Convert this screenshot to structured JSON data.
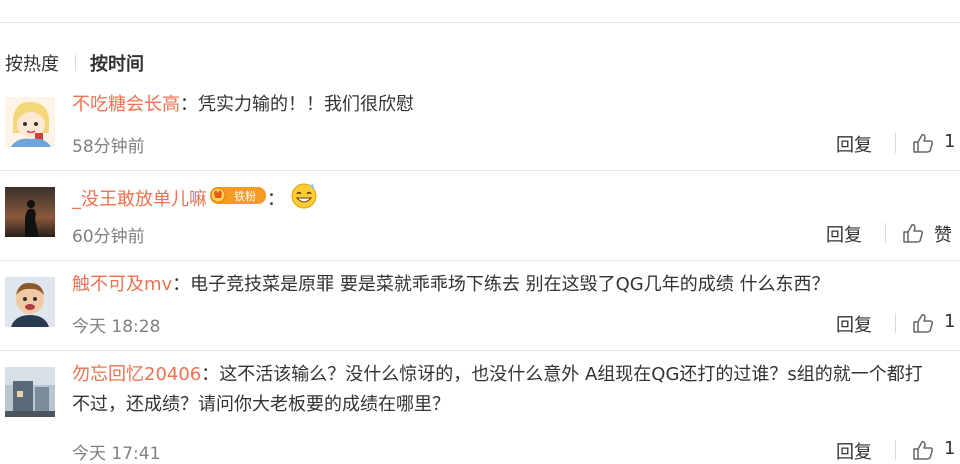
{
  "sort": {
    "hot_label": "按热度",
    "time_label": "按时间"
  },
  "comments": [
    {
      "username": "不吃糖会长高",
      "text": "：凭实力输的！！我们很欣慰",
      "time": "58分钟前",
      "reply_label": "回复",
      "like_label": "1"
    },
    {
      "username": "_没王敢放单儿嘛",
      "badge_text": "铁粉",
      "text": "：",
      "emoji": "grinning-sweat-emoji",
      "time": "60分钟前",
      "reply_label": "回复",
      "like_label": "赞"
    },
    {
      "username": "触不可及mv",
      "text": "：电子竞技菜是原罪 要是菜就乖乖场下练去 别在这毁了QG几年的成绩 什么东西？",
      "time": "今天 18:28",
      "reply_label": "回复",
      "like_label": "1"
    },
    {
      "username": "勿忘回忆20406",
      "text": "：这不活该输么？没什么惊讶的，也没什么意外 A组现在QG还打的过谁？s组的就一个都打不过，还成绩？请问你大老板要的成绩在哪里？",
      "time": "今天 17:41",
      "reply_label": "回复",
      "like_label": "1"
    }
  ],
  "colors": {
    "username": "#eb7350",
    "time": "#808080",
    "text": "#333333"
  }
}
